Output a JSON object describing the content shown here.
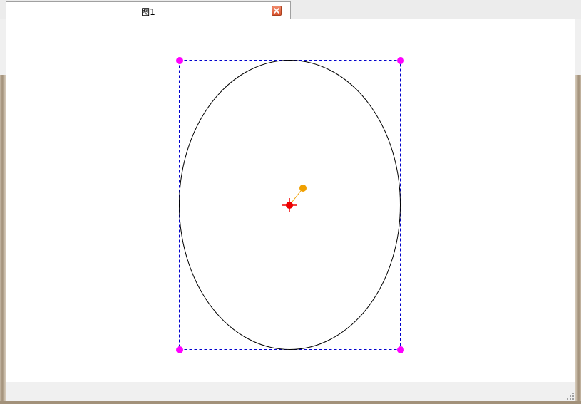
{
  "tab": {
    "title": "图1",
    "close_icon": "close-icon"
  },
  "drawing": {
    "shape": "ellipse",
    "bounding_box_color": "#0000cc",
    "ellipse_color": "#000000",
    "handle_color": "#ff00ff",
    "center_marker_color": "#ee0000",
    "rotation_handle_color": "#f0a000"
  }
}
